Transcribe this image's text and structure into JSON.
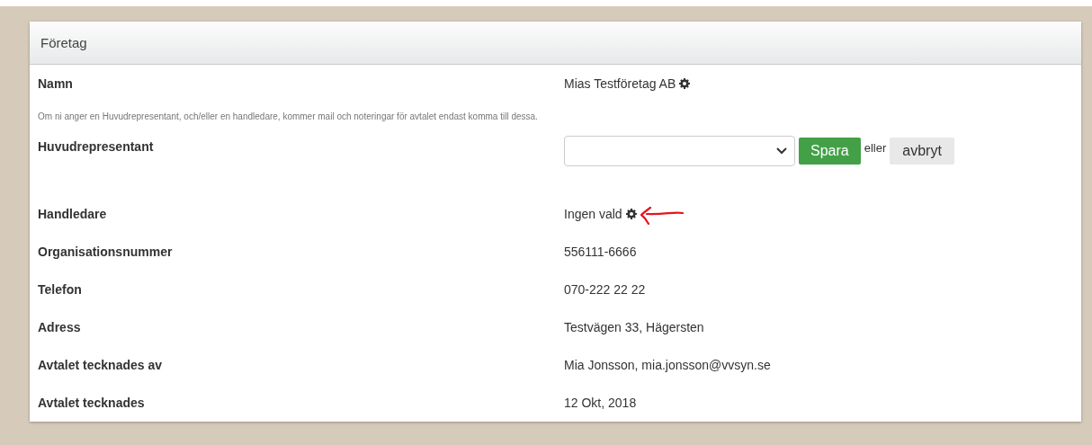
{
  "panel": {
    "title": "Företag"
  },
  "rows": [
    {
      "kind": "field",
      "label": "Namn",
      "value": "Mias Testföretag AB",
      "gear": true,
      "annotated": false
    },
    {
      "kind": "note",
      "text": "Om ni anger en Huvudrepresentant, och/eller en handledare, kommer mail och noteringar för avtalet endast komma till dessa."
    },
    {
      "kind": "select",
      "label": "Huvudrepresentant",
      "save": "Spara",
      "or": "eller",
      "cancel": "avbryt"
    },
    {
      "kind": "field",
      "label": "Handledare",
      "value": "Ingen vald",
      "gear": true,
      "annotated": true
    },
    {
      "kind": "field",
      "label": "Organisationsnummer",
      "value": "556111-6666",
      "gear": false,
      "annotated": false
    },
    {
      "kind": "field",
      "label": "Telefon",
      "value": "070-222 22 22",
      "gear": false,
      "annotated": false
    },
    {
      "kind": "field",
      "label": "Adress",
      "value": "Testvägen 33, Hägersten",
      "gear": false,
      "annotated": false
    },
    {
      "kind": "field",
      "label": "Avtalet tecknades av",
      "value": "Mia Jonsson, mia.jonsson@vvsyn.se",
      "gear": false,
      "annotated": false
    },
    {
      "kind": "field",
      "label": "Avtalet tecknades",
      "value": "12 Okt, 2018",
      "gear": false,
      "annotated": false
    }
  ]
}
